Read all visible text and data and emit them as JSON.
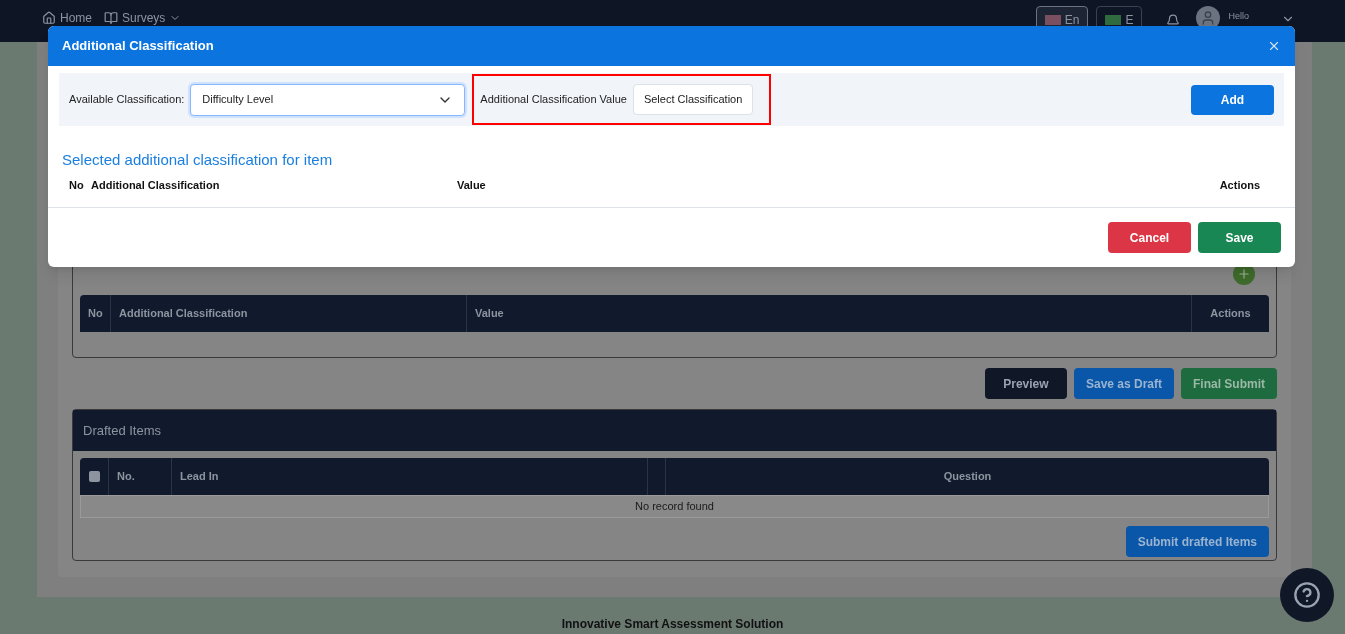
{
  "nav": {
    "links": [
      {
        "label": "Home"
      },
      {
        "label": "Surveys"
      }
    ],
    "languages": [
      {
        "label": "En",
        "selected": true
      },
      {
        "label": "E",
        "selected": false
      }
    ],
    "greeting": "Hello"
  },
  "page": {
    "classification_table": {
      "columns": [
        "No",
        "Additional Classification",
        "Value",
        "Actions"
      ]
    },
    "actions": [
      {
        "label": "Preview",
        "kind": "dark"
      },
      {
        "label": "Save as Draft",
        "kind": "primary"
      },
      {
        "label": "Final Submit",
        "kind": "success"
      }
    ],
    "drafted": {
      "title": "Drafted Items",
      "select_all_checked": false,
      "columns": [
        "No.",
        "Lead In",
        "",
        "Question"
      ],
      "empty": "No record found",
      "button": "Submit drafted Items"
    }
  },
  "footer": "Innovative Smart Assessment Solution",
  "modal": {
    "title": "Additional Classification",
    "available_label": "Available Classification:",
    "available_value": "Difficulty Level",
    "value_label": "Additional Classification Value",
    "value_button": "Select Classification",
    "highlighted": true,
    "add": "Add",
    "section_title": "Selected additional classification for item",
    "columns": [
      "No",
      "Additional Classification",
      "Value",
      "Actions"
    ],
    "buttons": [
      {
        "label": "Cancel",
        "kind": "danger"
      },
      {
        "label": "Save",
        "kind": "success"
      }
    ]
  }
}
